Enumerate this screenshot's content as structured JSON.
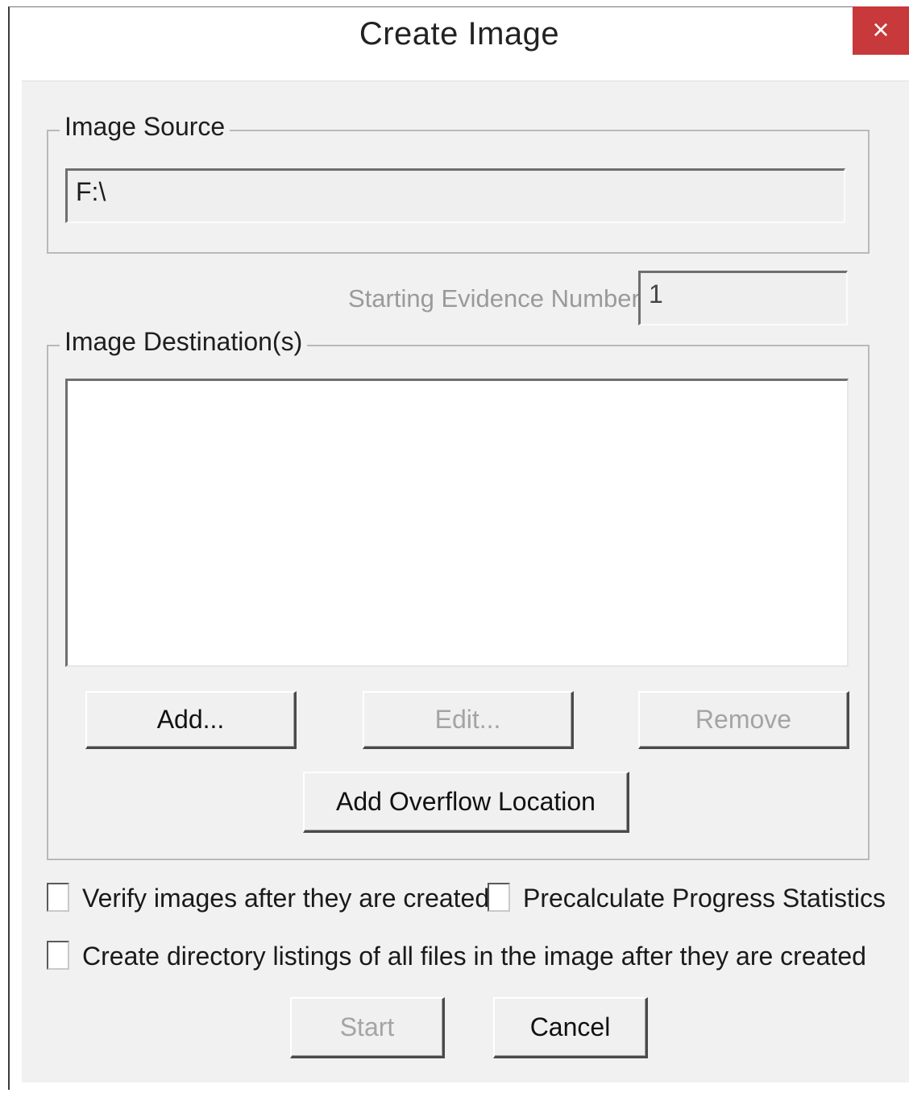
{
  "window": {
    "title": "Create Image",
    "close_glyph": "×"
  },
  "image_source": {
    "legend": "Image Source",
    "value": "F:\\"
  },
  "evidence": {
    "label": "Starting Evidence Number:",
    "value": "1"
  },
  "destinations": {
    "legend": "Image Destination(s)",
    "items": [],
    "add_label": "Add...",
    "edit_label": "Edit...",
    "remove_label": "Remove",
    "overflow_label": "Add Overflow Location"
  },
  "options": {
    "verify_label": "Verify images after they are created",
    "verify_checked": false,
    "precalc_label": "Precalculate Progress Statistics",
    "precalc_checked": false,
    "dirlist_label": "Create directory listings of all files in the image after they are created",
    "dirlist_checked": false
  },
  "footer": {
    "start_label": "Start",
    "cancel_label": "Cancel"
  },
  "colors": {
    "close_button": "#c7393a",
    "dialog_background": "#f1f1f1",
    "disabled_text": "#a4a4a4"
  },
  "icons": {
    "close": "close-icon"
  }
}
